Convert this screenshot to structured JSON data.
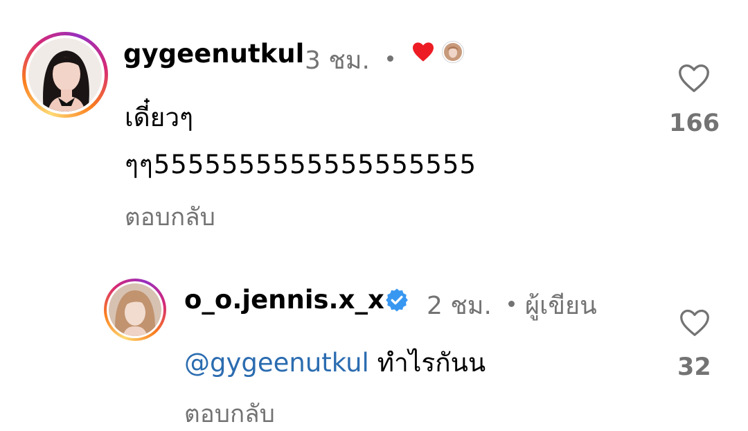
{
  "comments": [
    {
      "username": "gygeenutkul",
      "time": "3 ชม.",
      "text_line1": "เดี๋ยวๆ",
      "text_line2": "ๆๆ5555555555555555555",
      "reply": "ตอบกลับ",
      "likes": "166",
      "liked_by_author": true
    },
    {
      "username": "o_o.jennis.x_x",
      "verified": true,
      "time": "2 ชม.",
      "author_label": "ผู้เขียน",
      "mention": "@gygeenutkul",
      "text": "ทำไรกันน",
      "reply": "ตอบกลับ",
      "likes": "32"
    }
  ],
  "colors": {
    "meta_gray": "#737373",
    "heart_red": "#ed1c24",
    "mention_blue": "#2b6cb0",
    "verified_blue": "#3897f0"
  },
  "icons": [
    "heart-outline-icon",
    "heart-filled-icon",
    "verified-badge-icon"
  ]
}
